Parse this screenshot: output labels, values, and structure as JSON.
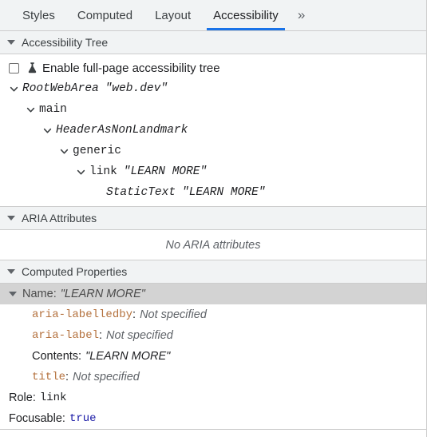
{
  "tabs": [
    {
      "label": "Styles",
      "active": false
    },
    {
      "label": "Computed",
      "active": false
    },
    {
      "label": "Layout",
      "active": false
    },
    {
      "label": "Accessibility",
      "active": true
    }
  ],
  "tab_overflow": "»",
  "accent_color": "#1a73e8",
  "sections": {
    "tree": {
      "title": "Accessibility Tree",
      "checkbox": {
        "label": "Enable full-page accessibility tree",
        "checked": false,
        "icon": "experiment-flask-icon"
      },
      "nodes": [
        {
          "indent": 0,
          "expanded": true,
          "role": "RootWebArea",
          "role_ignored": true,
          "name": "web.dev"
        },
        {
          "indent": 1,
          "expanded": true,
          "role": "main",
          "role_ignored": false,
          "name": ""
        },
        {
          "indent": 2,
          "expanded": true,
          "role": "HeaderAsNonLandmark",
          "role_ignored": true,
          "name": ""
        },
        {
          "indent": 3,
          "expanded": true,
          "role": "generic",
          "role_ignored": false,
          "name": ""
        },
        {
          "indent": 4,
          "expanded": true,
          "role": "link",
          "role_ignored": false,
          "name": "LEARN MORE"
        },
        {
          "indent": 5,
          "expanded": false,
          "role": "StaticText",
          "role_ignored": true,
          "name": "LEARN MORE"
        }
      ]
    },
    "aria": {
      "title": "ARIA Attributes",
      "empty_text": "No ARIA attributes"
    },
    "computed": {
      "title": "Computed Properties",
      "rows": [
        {
          "key": "Name",
          "key_style": "sans",
          "value": "LEARN MORE",
          "value_style": "quoted",
          "indent": "top",
          "selected": true,
          "expander": true
        },
        {
          "key": "aria-labelledby",
          "key_style": "mono",
          "value": "Not specified",
          "value_style": "italic",
          "indent": "sub",
          "selected": false,
          "expander": false
        },
        {
          "key": "aria-label",
          "key_style": "mono",
          "value": "Not specified",
          "value_style": "italic",
          "indent": "sub",
          "selected": false,
          "expander": false
        },
        {
          "key": "Contents",
          "key_style": "sans",
          "value": "LEARN MORE",
          "value_style": "quoted",
          "indent": "sub",
          "selected": false,
          "expander": false
        },
        {
          "key": "title",
          "key_style": "mono",
          "value": "Not specified",
          "value_style": "italic",
          "indent": "sub",
          "selected": false,
          "expander": false
        },
        {
          "key": "Role",
          "key_style": "sans",
          "value": "link",
          "value_style": "mono",
          "indent": "top",
          "selected": false,
          "expander": false
        },
        {
          "key": "Focusable",
          "key_style": "sans",
          "value": "true",
          "value_style": "bool",
          "indent": "top",
          "selected": false,
          "expander": false
        }
      ]
    }
  }
}
